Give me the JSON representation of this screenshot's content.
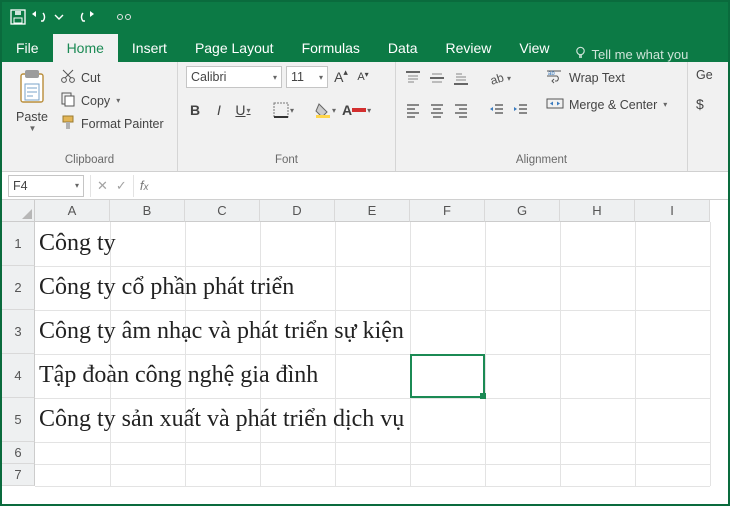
{
  "qat": {
    "save": "save",
    "undo": "undo",
    "redo": "redo"
  },
  "tabs": {
    "file": "File",
    "home": "Home",
    "insert": "Insert",
    "pagelayout": "Page Layout",
    "formulas": "Formulas",
    "data": "Data",
    "review": "Review",
    "view": "View",
    "tellme": "Tell me what you"
  },
  "ribbon": {
    "clipboard": {
      "label": "Clipboard",
      "paste": "Paste",
      "cut": "Cut",
      "copy": "Copy",
      "format_painter": "Format Painter"
    },
    "font": {
      "label": "Font",
      "name": "Calibri",
      "size": "11",
      "bold": "B",
      "italic": "I",
      "underline": "U"
    },
    "alignment": {
      "label": "Alignment",
      "wrap": "Wrap Text",
      "merge": "Merge & Center"
    },
    "number": {
      "general": "Ge",
      "dollar": "$"
    }
  },
  "namebox": "F4",
  "columns": [
    "A",
    "B",
    "C",
    "D",
    "E",
    "F",
    "G",
    "H",
    "I"
  ],
  "rows_tall": [
    1,
    2,
    3,
    4,
    5
  ],
  "rows_short": [
    6,
    7
  ],
  "cells": {
    "A1": "Công ty",
    "A2": "Công ty cổ phần phát triển",
    "A3": "Công ty âm nhạc và phát triển sự kiện",
    "A4": "Tập đoàn công nghệ gia đình",
    "A5": "Công ty sản xuất và phát triển dịch vụ"
  },
  "selected": "F4"
}
